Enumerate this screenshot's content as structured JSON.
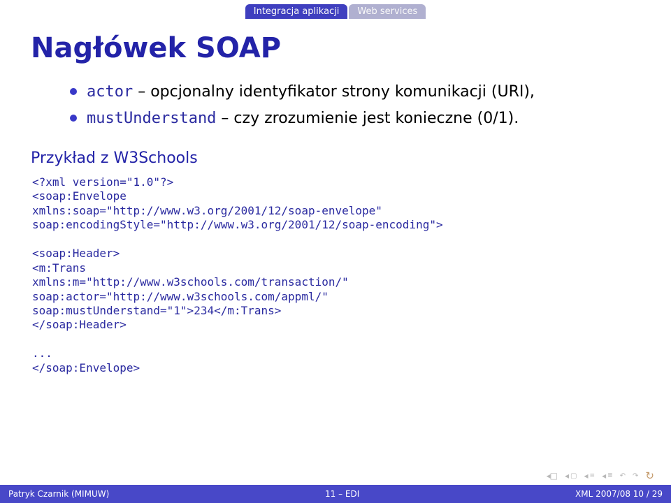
{
  "tabs": {
    "active": "Integracja aplikacji",
    "inactive": "Web services"
  },
  "title": "Nagłówek SOAP",
  "bullets": [
    {
      "code": "actor",
      "text": " – opcjonalny identyfikator strony komunikacji (URI),"
    },
    {
      "code": "mustUnderstand",
      "text": " – czy zrozumienie jest konieczne (0/1)."
    }
  ],
  "subheading": "Przykład z W3Schools",
  "code": "<?xml version=\"1.0\"?>\n<soap:Envelope\nxmlns:soap=\"http://www.w3.org/2001/12/soap-envelope\"\nsoap:encodingStyle=\"http://www.w3.org/2001/12/soap-encoding\">\n\n<soap:Header>\n<m:Trans\nxmlns:m=\"http://www.w3schools.com/transaction/\"\nsoap:actor=\"http://www.w3schools.com/appml/\"\nsoap:mustUnderstand=\"1\">234</m:Trans>\n</soap:Header>\n\n...\n</soap:Envelope>",
  "footer": {
    "left": "Patryk Czarnik (MIMUW)",
    "center": "11 – EDI",
    "right": "XML 2007/08     10 / 29"
  }
}
